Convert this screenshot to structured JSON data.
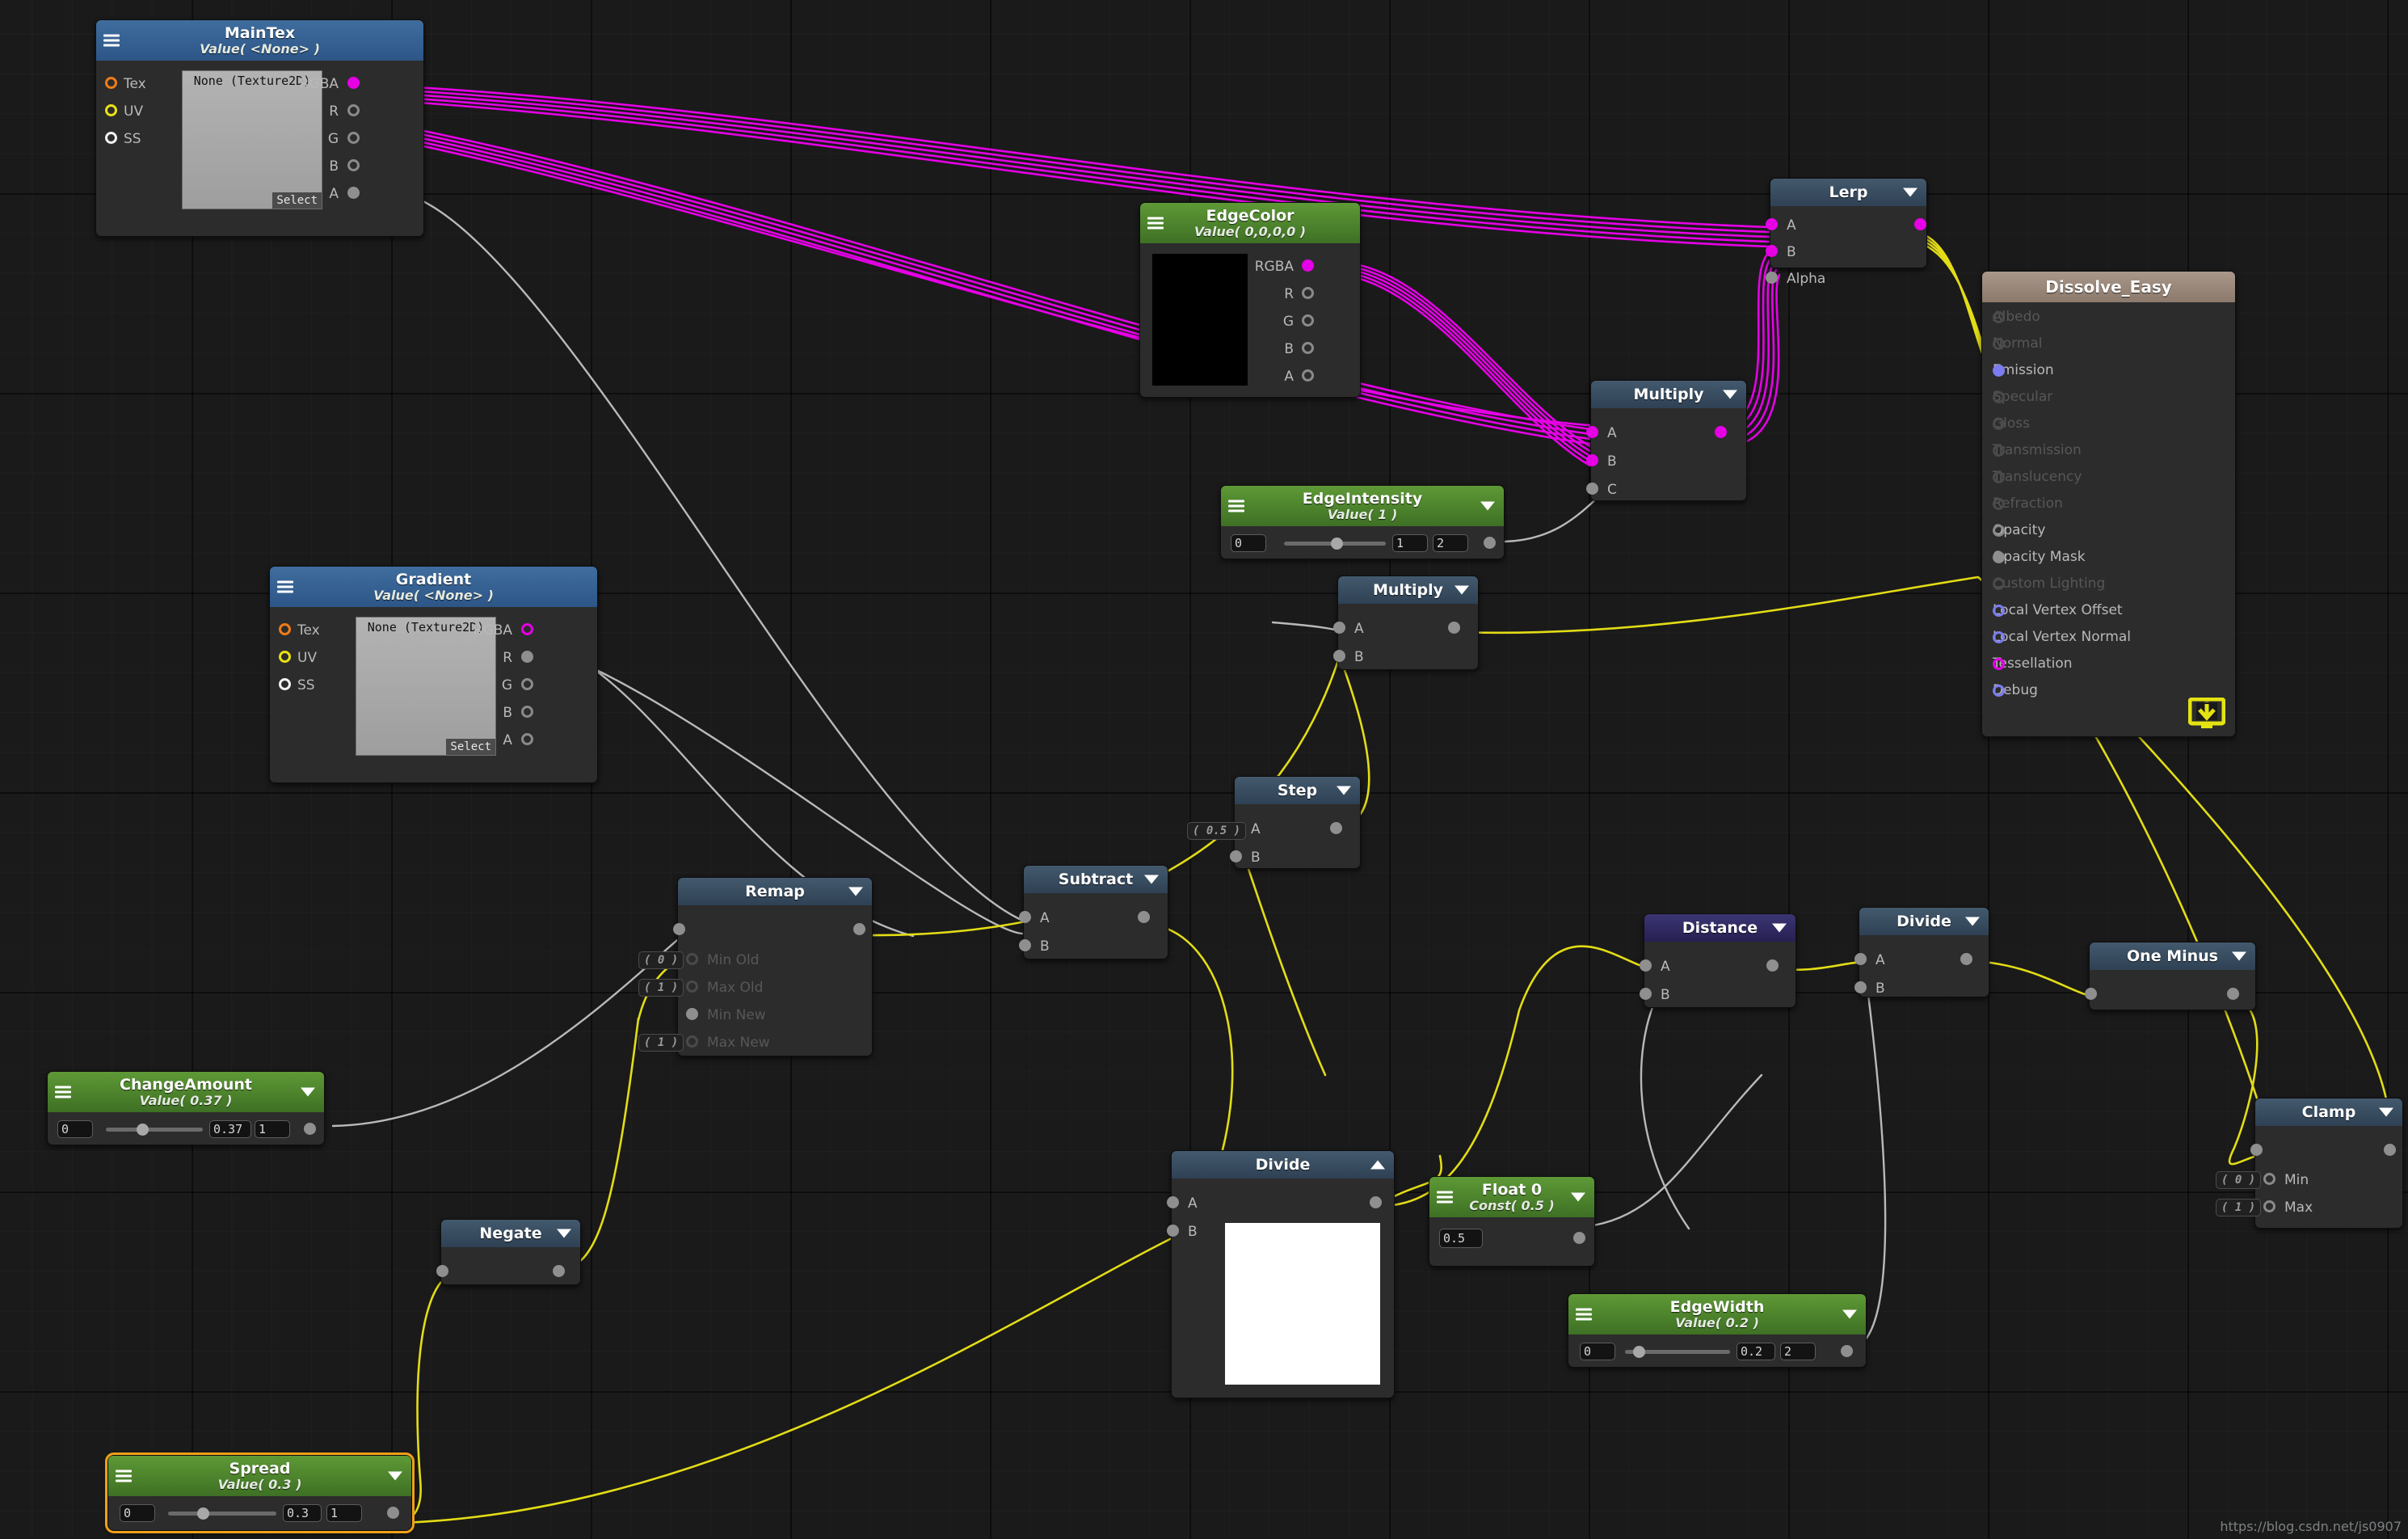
{
  "app": {
    "watermark": "https://blog.csdn.net/js0907"
  },
  "colors": {
    "wire_color": "#e600e6",
    "wire_float": "#e3dc16",
    "wire_gray": "#b9b9b9",
    "accent_selected": "#f0a019",
    "header_property": "#5e9936",
    "header_texture": "#3f6d9e",
    "header_op": "#43596d",
    "header_distance": "#3b3573",
    "header_master": "#a9978a"
  },
  "nodes": {
    "maintex": {
      "title": "MainTex",
      "subtitle": "Value( <None> )",
      "texture_label": "None (Texture2D)",
      "select_label": "Select",
      "inputs": [
        "Tex",
        "UV",
        "SS"
      ],
      "outputs": [
        "RGBA",
        "R",
        "G",
        "B",
        "A"
      ]
    },
    "gradient": {
      "title": "Gradient",
      "subtitle": "Value( <None> )",
      "texture_label": "None (Texture2D)",
      "select_label": "Select",
      "inputs": [
        "Tex",
        "UV",
        "SS"
      ],
      "outputs": [
        "RGBA",
        "R",
        "G",
        "B",
        "A"
      ]
    },
    "edgecolor": {
      "title": "EdgeColor",
      "subtitle": "Value( 0,0,0,0 )",
      "swatch_color": "#000000",
      "outputs": [
        "RGBA",
        "R",
        "G",
        "B",
        "A"
      ]
    },
    "edgeintensity": {
      "title": "EdgeIntensity",
      "subtitle": "Value( 1 )",
      "min": "0",
      "value": "1",
      "max": "2"
    },
    "changeamount": {
      "title": "ChangeAmount",
      "subtitle": "Value( 0.37 )",
      "min": "0",
      "value": "0.37",
      "max": "1"
    },
    "spread": {
      "title": "Spread",
      "subtitle": "Value( 0.3 )",
      "min": "0",
      "value": "0.3",
      "max": "1",
      "selected": true
    },
    "edgewidth": {
      "title": "EdgeWidth",
      "subtitle": "Value( 0.2 )",
      "min": "0",
      "value": "0.2",
      "max": "2"
    },
    "float0": {
      "title": "Float 0",
      "subtitle": "Const( 0.5 )",
      "value": "0.5"
    },
    "lerp": {
      "title": "Lerp",
      "inputs": [
        "A",
        "B",
        "Alpha"
      ]
    },
    "multiply_top": {
      "title": "Multiply",
      "inputs": [
        "A",
        "B",
        "C"
      ]
    },
    "multiply_mid": {
      "title": "Multiply",
      "inputs": [
        "A",
        "B"
      ]
    },
    "step": {
      "title": "Step",
      "inputs": [
        "A",
        "B"
      ],
      "default_a": "( 0.5 )"
    },
    "subtract": {
      "title": "Subtract",
      "inputs": [
        "A",
        "B"
      ]
    },
    "remap": {
      "title": "Remap",
      "inputs": [
        "Min Old",
        "Max Old",
        "Min New",
        "Max New"
      ],
      "defaults": [
        "( 0 )",
        "( 1 )",
        "",
        "( 1 )"
      ]
    },
    "negate": {
      "title": "Negate"
    },
    "divide_preview": {
      "title": "Divide",
      "inputs": [
        "A",
        "B"
      ],
      "collapsed": false
    },
    "distance": {
      "title": "Distance",
      "inputs": [
        "A",
        "B"
      ]
    },
    "divide_right": {
      "title": "Divide",
      "inputs": [
        "A",
        "B"
      ]
    },
    "oneminus": {
      "title": "One Minus"
    },
    "clamp": {
      "title": "Clamp",
      "inputs": [
        "Min",
        "Max"
      ],
      "defaults": [
        "( 0 )",
        "( 1 )"
      ]
    },
    "master": {
      "title": "Dissolve_Easy",
      "ports": [
        {
          "label": "Albedo",
          "state": "off"
        },
        {
          "label": "Normal",
          "state": "off"
        },
        {
          "label": "Emission",
          "state": "connected-blue"
        },
        {
          "label": "Specular",
          "state": "off"
        },
        {
          "label": "Gloss",
          "state": "off"
        },
        {
          "label": "Transmission",
          "state": "off"
        },
        {
          "label": "Translucency",
          "state": "off"
        },
        {
          "label": "Refraction",
          "state": "off"
        },
        {
          "label": "Opacity",
          "state": "empty"
        },
        {
          "label": "Opacity Mask",
          "state": "connected-gray"
        },
        {
          "label": "Custom Lighting",
          "state": "off"
        },
        {
          "label": "Local Vertex Offset",
          "state": "ring-blue"
        },
        {
          "label": "Local Vertex Normal",
          "state": "ring-blue"
        },
        {
          "label": "Tessellation",
          "state": "ring-mag"
        },
        {
          "label": "Debug",
          "state": "ring-blue"
        }
      ],
      "download_icon": "download-icon"
    }
  }
}
